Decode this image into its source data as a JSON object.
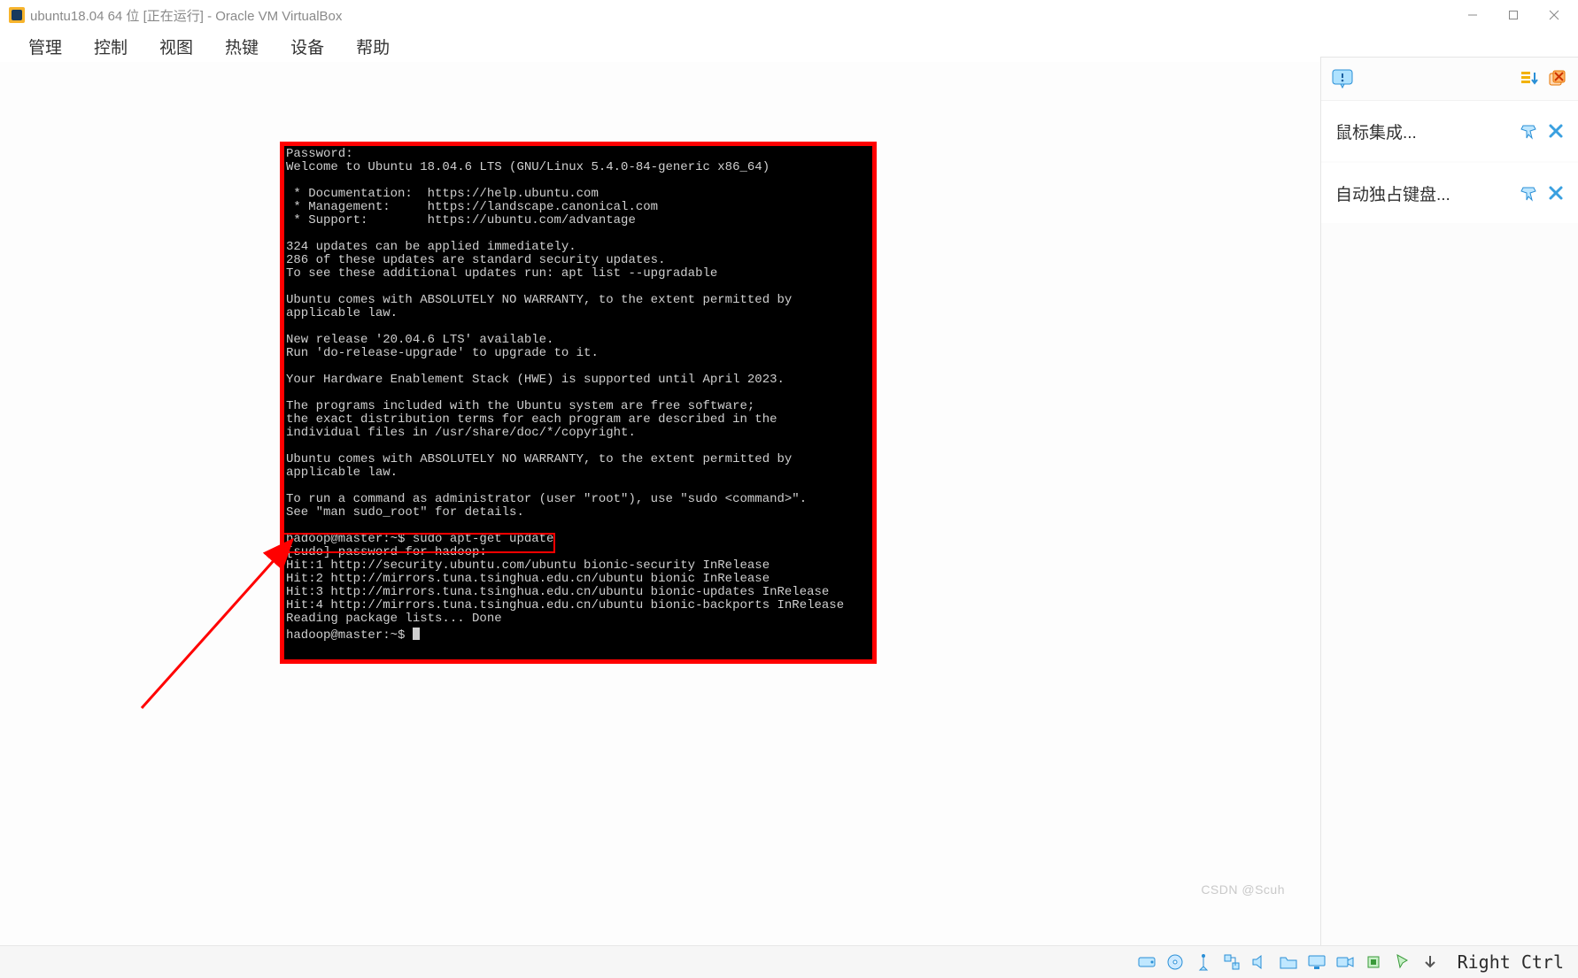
{
  "title": "ubuntu18.04 64 位 [正在运行] - Oracle VM VirtualBox",
  "menu": {
    "m1": "管理",
    "m2": "控制",
    "m3": "视图",
    "m4": "热键",
    "m5": "设备",
    "m6": "帮助"
  },
  "sidebar": {
    "row1_label": "鼠标集成...",
    "row2_label": "自动独占键盘..."
  },
  "terminal": {
    "text": "Password:\nWelcome to Ubuntu 18.04.6 LTS (GNU/Linux 5.4.0-84-generic x86_64)\n\n * Documentation:  https://help.ubuntu.com\n * Management:     https://landscape.canonical.com\n * Support:        https://ubuntu.com/advantage\n\n324 updates can be applied immediately.\n286 of these updates are standard security updates.\nTo see these additional updates run: apt list --upgradable\n\nUbuntu comes with ABSOLUTELY NO WARRANTY, to the extent permitted by\napplicable law.\n\nNew release '20.04.6 LTS' available.\nRun 'do-release-upgrade' to upgrade to it.\n\nYour Hardware Enablement Stack (HWE) is supported until April 2023.\n\nThe programs included with the Ubuntu system are free software;\nthe exact distribution terms for each program are described in the\nindividual files in /usr/share/doc/*/copyright.\n\nUbuntu comes with ABSOLUTELY NO WARRANTY, to the extent permitted by\napplicable law.\n\nTo run a command as administrator (user \"root\"), use \"sudo <command>\".\nSee \"man sudo_root\" for details.\n\nhadoop@master:~$ sudo apt-get update\n[sudo] password for hadoop:\nHit:1 http://security.ubuntu.com/ubuntu bionic-security InRelease\nHit:2 http://mirrors.tuna.tsinghua.edu.cn/ubuntu bionic InRelease\nHit:3 http://mirrors.tuna.tsinghua.edu.cn/ubuntu bionic-updates InRelease\nHit:4 http://mirrors.tuna.tsinghua.edu.cn/ubuntu bionic-backports InRelease\nReading package lists... Done\nhadoop@master:~$ "
  },
  "highlighted_command": "hadoop@master:~$ sudo apt-get update",
  "statusbar": {
    "hostkey": "Right Ctrl"
  },
  "watermark": "CSDN @Scuh"
}
